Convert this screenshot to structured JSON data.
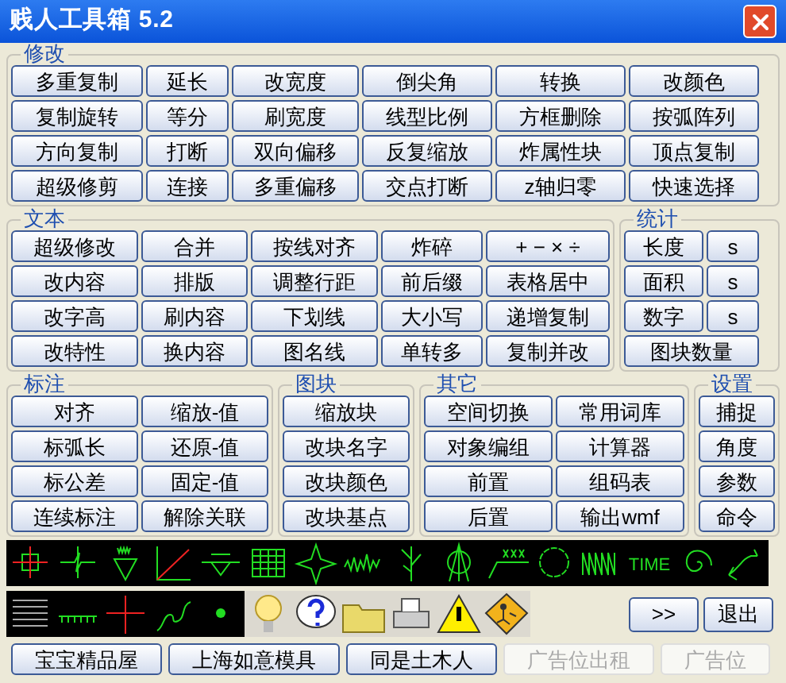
{
  "window": {
    "title": "贱人工具箱 5.2"
  },
  "modify": {
    "label": "修改",
    "rows": [
      [
        "多重复制",
        "延长",
        "改宽度",
        "倒尖角",
        "转换",
        "改颜色"
      ],
      [
        "复制旋转",
        "等分",
        "刷宽度",
        "线型比例",
        "方框删除",
        "按弧阵列"
      ],
      [
        "方向复制",
        "打断",
        "双向偏移",
        "反复缩放",
        "炸属性块",
        "顶点复制"
      ],
      [
        "超级修剪",
        "连接",
        "多重偏移",
        "交点打断",
        "z轴归零",
        "快速选择"
      ]
    ]
  },
  "text": {
    "label": "文本",
    "rows": [
      [
        "超级修改",
        "合并",
        "按线对齐",
        "炸碎",
        "+ − × ÷"
      ],
      [
        "改内容",
        "排版",
        "调整行距",
        "前后缀",
        "表格居中"
      ],
      [
        "改字高",
        "刷内容",
        "下划线",
        "大小写",
        "递增复制"
      ],
      [
        "改特性",
        "换内容",
        "图名线",
        "单转多",
        "复制并改"
      ]
    ]
  },
  "stats": {
    "label": "统计",
    "rows": [
      [
        "长度",
        "s"
      ],
      [
        "面积",
        "s"
      ],
      [
        "数字",
        "s"
      ],
      [
        "图块数量"
      ]
    ]
  },
  "dimension": {
    "label": "标注",
    "rows": [
      [
        "对齐",
        "缩放-值"
      ],
      [
        "标弧长",
        "还原-值"
      ],
      [
        "标公差",
        "固定-值"
      ],
      [
        "连续标注",
        "解除关联"
      ]
    ]
  },
  "block": {
    "label": "图块",
    "rows": [
      [
        "缩放块"
      ],
      [
        "改块名字"
      ],
      [
        "改块颜色"
      ],
      [
        "改块基点"
      ]
    ]
  },
  "other": {
    "label": "其它",
    "rows": [
      [
        "空间切换",
        "常用词库"
      ],
      [
        "对象编组",
        "计算器"
      ],
      [
        "前置",
        "组码表"
      ],
      [
        "后置",
        "输出wmf"
      ]
    ]
  },
  "settings": {
    "label": "设置",
    "rows": [
      [
        "捕捉"
      ],
      [
        "角度"
      ],
      [
        "参数"
      ],
      [
        "命令"
      ]
    ]
  },
  "tools_row_1": [
    {
      "kind": "crosshair"
    },
    {
      "kind": "breakline"
    },
    {
      "kind": "leader"
    },
    {
      "kind": "diagonal"
    },
    {
      "kind": "elevation"
    },
    {
      "kind": "table"
    },
    {
      "kind": "star"
    },
    {
      "kind": "wave"
    },
    {
      "kind": "tree"
    },
    {
      "kind": "compass"
    },
    {
      "kind": "label"
    },
    {
      "kind": "cloud"
    },
    {
      "kind": "zigzag"
    },
    {
      "kind": "text",
      "label": "TIME"
    },
    {
      "kind": "spiral"
    },
    {
      "kind": "arrow"
    }
  ],
  "tools_row_2": [
    {
      "kind": "hatch"
    },
    {
      "kind": "ruler"
    },
    {
      "kind": "cross"
    },
    {
      "kind": "curve"
    },
    {
      "kind": "dot"
    },
    {
      "kind": "bulb"
    },
    {
      "kind": "help"
    },
    {
      "kind": "folder"
    },
    {
      "kind": "printer"
    },
    {
      "kind": "warning"
    },
    {
      "kind": "construction"
    }
  ],
  "actions": [
    ">>",
    "退出"
  ],
  "links": [
    {
      "label": "宝宝精品屋",
      "disabled": false
    },
    {
      "label": "上海如意模具",
      "disabled": false
    },
    {
      "label": "同是土木人",
      "disabled": false
    },
    {
      "label": "广告位出租",
      "disabled": true
    },
    {
      "label": "广告位",
      "disabled": true
    }
  ]
}
